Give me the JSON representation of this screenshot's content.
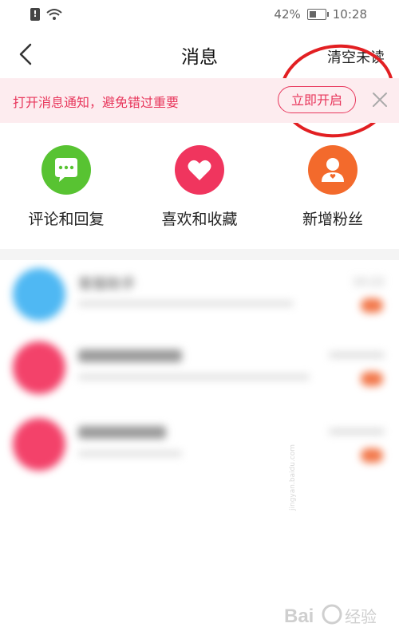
{
  "status_bar": {
    "battery": "42%",
    "time": "10:28"
  },
  "header": {
    "title": "消息",
    "clear_unread": "清空未读"
  },
  "banner": {
    "text": "打开消息通知，避免错过重要",
    "button": "立即开启"
  },
  "categories": [
    {
      "label": "评论和回复",
      "icon": "comment-icon",
      "color": "#58c332"
    },
    {
      "label": "喜欢和收藏",
      "icon": "heart-icon",
      "color": "#f0355e"
    },
    {
      "label": "新增粉丝",
      "icon": "user-icon",
      "color": "#f36a2c"
    }
  ],
  "messages": [
    {
      "title": "客服助手",
      "time": "10:22",
      "avatar_color": "#4fb8f3"
    },
    {
      "title": "",
      "time": "",
      "avatar_color": "#f3426a"
    },
    {
      "title": "",
      "time": "",
      "avatar_color": "#f3426a"
    }
  ],
  "watermark": {
    "text": "Bai 经验",
    "url": "jingyan.baidu.com"
  },
  "colors": {
    "accent": "#e8375c",
    "banner_bg": "#fdecef",
    "annotation": "#e21f22"
  }
}
